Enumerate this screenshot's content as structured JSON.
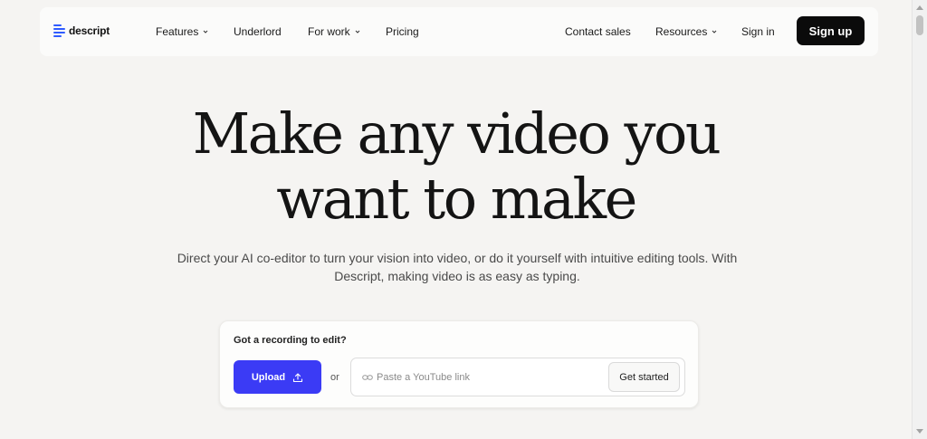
{
  "brand": {
    "name": "descript",
    "accent_color": "#2f5bff"
  },
  "nav": {
    "links": [
      {
        "label": "Features",
        "has_dropdown": true
      },
      {
        "label": "Underlord",
        "has_dropdown": false
      },
      {
        "label": "For work",
        "has_dropdown": true
      },
      {
        "label": "Pricing",
        "has_dropdown": false
      }
    ],
    "right_links": [
      {
        "label": "Contact sales",
        "has_dropdown": false
      },
      {
        "label": "Resources",
        "has_dropdown": true
      },
      {
        "label": "Sign in",
        "has_dropdown": false
      }
    ],
    "signup_label": "Sign up"
  },
  "hero": {
    "title_line1": "Make any video you",
    "title_line2": "want to make",
    "subtitle": "Direct your AI co-editor to turn your vision into video, or do it yourself with intuitive editing tools. With Descript, making video is as easy as typing."
  },
  "upload_card": {
    "label": "Got a recording to edit?",
    "upload_label": "Upload",
    "upload_color": "#3b3bf5",
    "or_text": "or",
    "youtube_placeholder": "Paste a YouTube link",
    "youtube_value": "",
    "get_started_label": "Get started"
  }
}
